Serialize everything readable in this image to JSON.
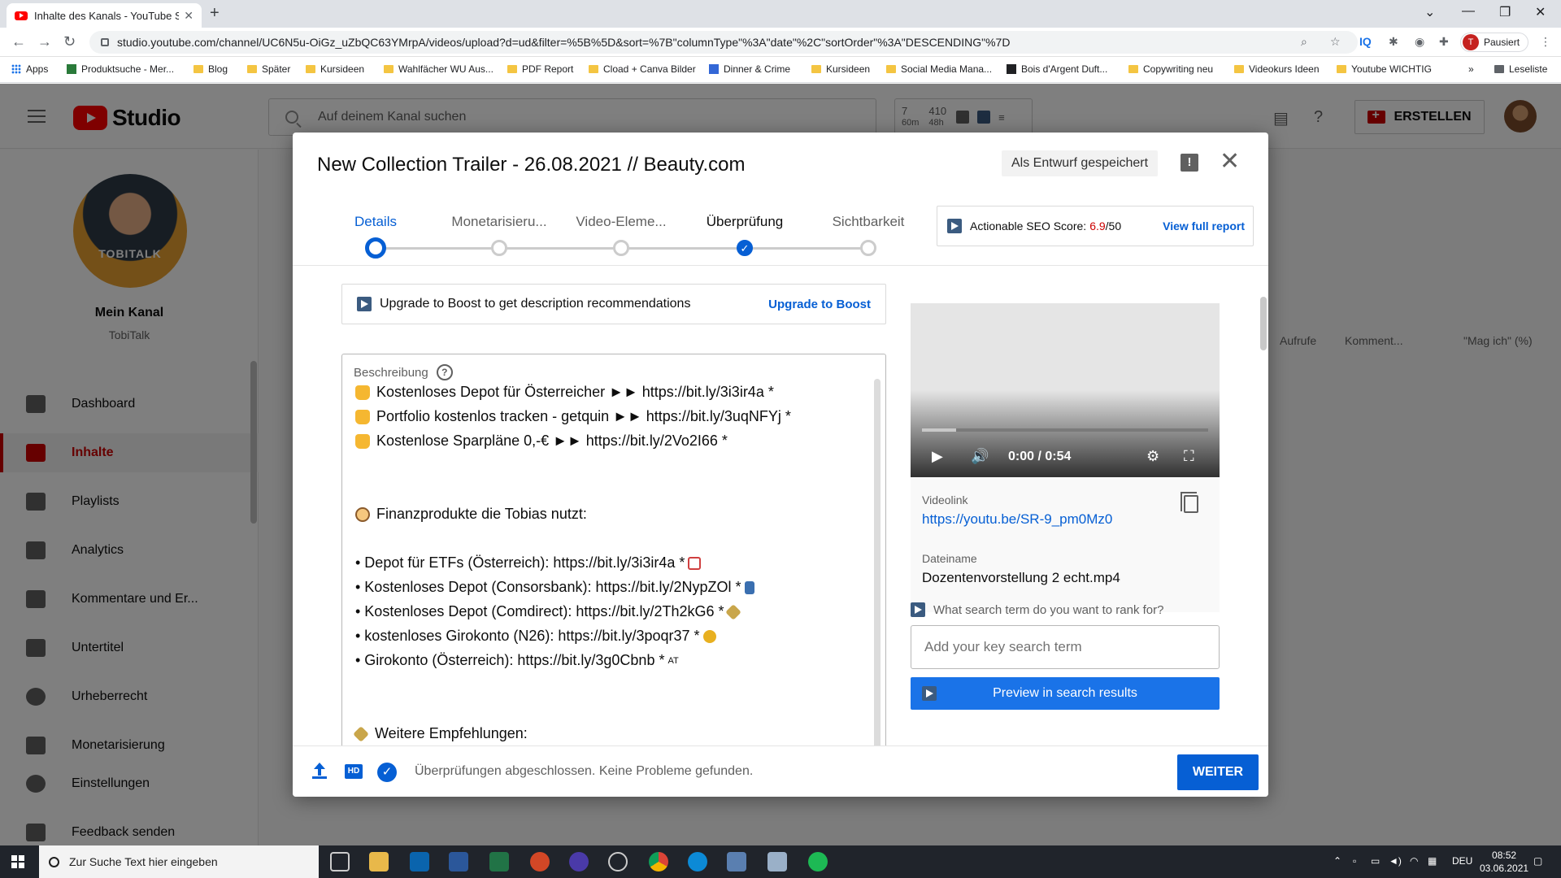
{
  "browser": {
    "tab_title": "Inhalte des Kanals - YouTube Stu",
    "url": "studio.youtube.com/channel/UC6N5u-OiGz_uZbQC63YMrpA/videos/upload?d=ud&filter=%5B%5D&sort=%7B\"columnType\"%3A\"date\"%2C\"sortOrder\"%3A\"DESCENDING\"%7D",
    "profile_label": "Pausiert",
    "profile_initial": "T",
    "bookmarks": [
      "Apps",
      "Produktsuche - Mer...",
      "Blog",
      "Später",
      "Kursideen",
      "Wahlfächer WU Aus...",
      "PDF Report",
      "Cload + Canva Bilder",
      "Dinner & Crime",
      "Kursideen",
      "Social Media Mana...",
      "Bois d'Argent Duft...",
      "Copywriting neu",
      "Videokurs Ideen",
      "Youtube WICHTIG"
    ],
    "reading_list": "Leseliste",
    "more_bookmarks": "»"
  },
  "header": {
    "logo_text": "Studio",
    "search_placeholder": "Auf deinem Kanal suchen",
    "stat1_value": "7",
    "stat1_unit": "60m",
    "stat2_value": "410",
    "stat2_unit": "48h",
    "create_label": "ERSTELLEN"
  },
  "sidebar": {
    "avatar_text": "TOBITALK",
    "channel_label": "Mein Kanal",
    "channel_name": "TobiTalk",
    "items": [
      {
        "label": "Dashboard"
      },
      {
        "label": "Inhalte"
      },
      {
        "label": "Playlists"
      },
      {
        "label": "Analytics"
      },
      {
        "label": "Kommentare und Er..."
      },
      {
        "label": "Untertitel"
      },
      {
        "label": "Urheberrecht"
      },
      {
        "label": "Monetarisierung"
      },
      {
        "label": "Einstellungen"
      },
      {
        "label": "Feedback senden"
      }
    ]
  },
  "background_table": {
    "col_views": "Aufrufe",
    "col_comments": "Komment...",
    "col_likes": "\"Mag ich\" (%)"
  },
  "dialog": {
    "title": "New Collection Trailer - 26.08.2021 // Beauty.com",
    "draft_label": "Als Entwurf gespeichert",
    "steps": [
      {
        "label": "Details"
      },
      {
        "label": "Monetarisieru..."
      },
      {
        "label": "Video-Eleme..."
      },
      {
        "label": "Überprüfung"
      },
      {
        "label": "Sichtbarkeit"
      }
    ],
    "seo": {
      "label": "Actionable SEO Score:",
      "score": "6.9",
      "max": "/50",
      "link": "View full report"
    },
    "boost": {
      "text": "Upgrade to Boost to get description recommendations",
      "link": "Upgrade to Boost"
    },
    "description": {
      "label": "Beschreibung",
      "lines": [
        "Kostenloses Depot für Österreicher ►► https://bit.ly/3i3ir4a *",
        "Portfolio kostenlos tracken - getquin ►► https://bit.ly/3uqNFYj *",
        "Kostenlose Sparpläne 0,-€ ►► https://bit.ly/2Vo2I66 *",
        "Finanzprodukte die Tobias nutzt:",
        "• Depot für ETFs (Österreich): https://bit.ly/3i3ir4a *",
        "• Kostenloses Depot (Consorsbank): https://bit.ly/2NypZOl *",
        "• Kostenloses Depot (Comdirect): https://bit.ly/2Th2kG6 *",
        "• kostenloses Girokonto (N26): https://bit.ly/3poqr37 *",
        "• Girokonto (Österreich): https://bit.ly/3g0Cbnb *",
        "Weitere Empfehlungen:"
      ],
      "at_badge": "AT"
    },
    "video": {
      "time": "0:00 / 0:54",
      "link_label": "Videolink",
      "link": "https://youtu.be/SR-9_pm0Mz0",
      "filename_label": "Dateiname",
      "filename": "Dozentenvorstellung 2 echt.mp4"
    },
    "rank": {
      "question": "What search term do you want to rank for?",
      "placeholder": "Add your key search term",
      "preview_button": "Preview in search results"
    },
    "footer": {
      "hd": "HD",
      "status": "Überprüfungen abgeschlossen. Keine Probleme gefunden.",
      "next": "WEITER"
    }
  },
  "taskbar": {
    "search_placeholder": "Zur Suche Text hier eingeben",
    "lang": "DEU",
    "time": "08:52",
    "date": "03.06.2021"
  }
}
